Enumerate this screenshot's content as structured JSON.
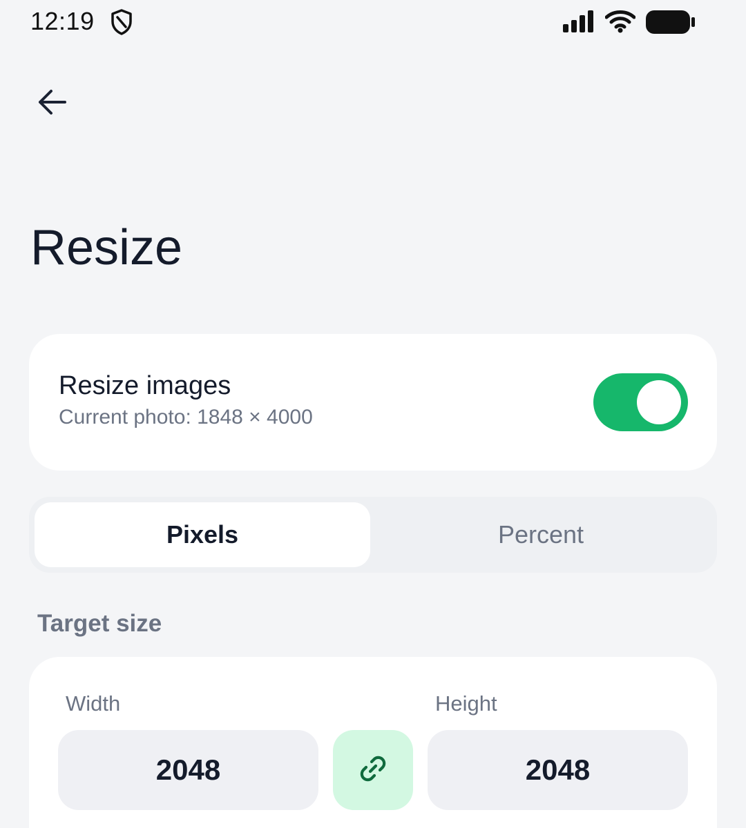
{
  "status_bar": {
    "time": "12:19",
    "icons": [
      "shield-icon",
      "signal-icon",
      "wifi-icon",
      "battery-icon"
    ]
  },
  "header": {
    "back_icon": "arrow-left-icon",
    "title": "Resize"
  },
  "resize_toggle": {
    "title": "Resize images",
    "subtitle": "Current photo: 1848 × 4000",
    "enabled": true
  },
  "units": {
    "options": [
      "Pixels",
      "Percent"
    ],
    "selected": "Pixels"
  },
  "target_size": {
    "label": "Target size",
    "width_label": "Width",
    "width_value": "2048",
    "height_label": "Height",
    "height_value": "2048",
    "link_icon": "link-icon"
  },
  "colors": {
    "accent": "#16b76b",
    "link_bg": "#d3f8e2",
    "link_fg": "#0f6b3d",
    "background": "#f4f5f7",
    "muted_text": "#6b7383"
  }
}
